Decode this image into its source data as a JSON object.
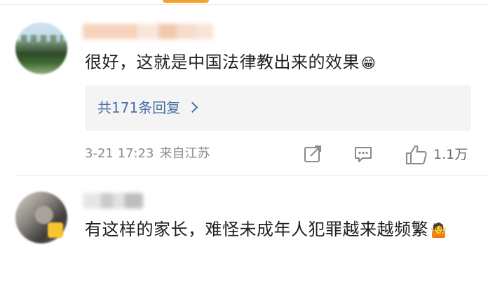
{
  "colors": {
    "accent_orange": "#f3a42a",
    "link_blue": "#4a6fa5",
    "meta_gray": "#8b8b8b",
    "reply_box_bg": "#f4f4f4"
  },
  "comments": [
    {
      "text": "很好，这就是中国法律教出来的效果",
      "emoji_name": "grinning-face-icon",
      "emoji_glyph": "😁",
      "replies_label": "共171条回复",
      "timestamp": "3-21 17:23",
      "source": "来自江苏",
      "like_count": "1.1万"
    },
    {
      "text": "有这样的家长，难怪未成年人犯罪越来越频繁",
      "emoji_name": "shrugging-person-icon",
      "emoji_glyph": "🤷"
    }
  ],
  "icons": {
    "share": "share-icon",
    "comment": "comment-icon",
    "like": "thumbs-up-icon",
    "chevron": "chevron-right-icon"
  }
}
